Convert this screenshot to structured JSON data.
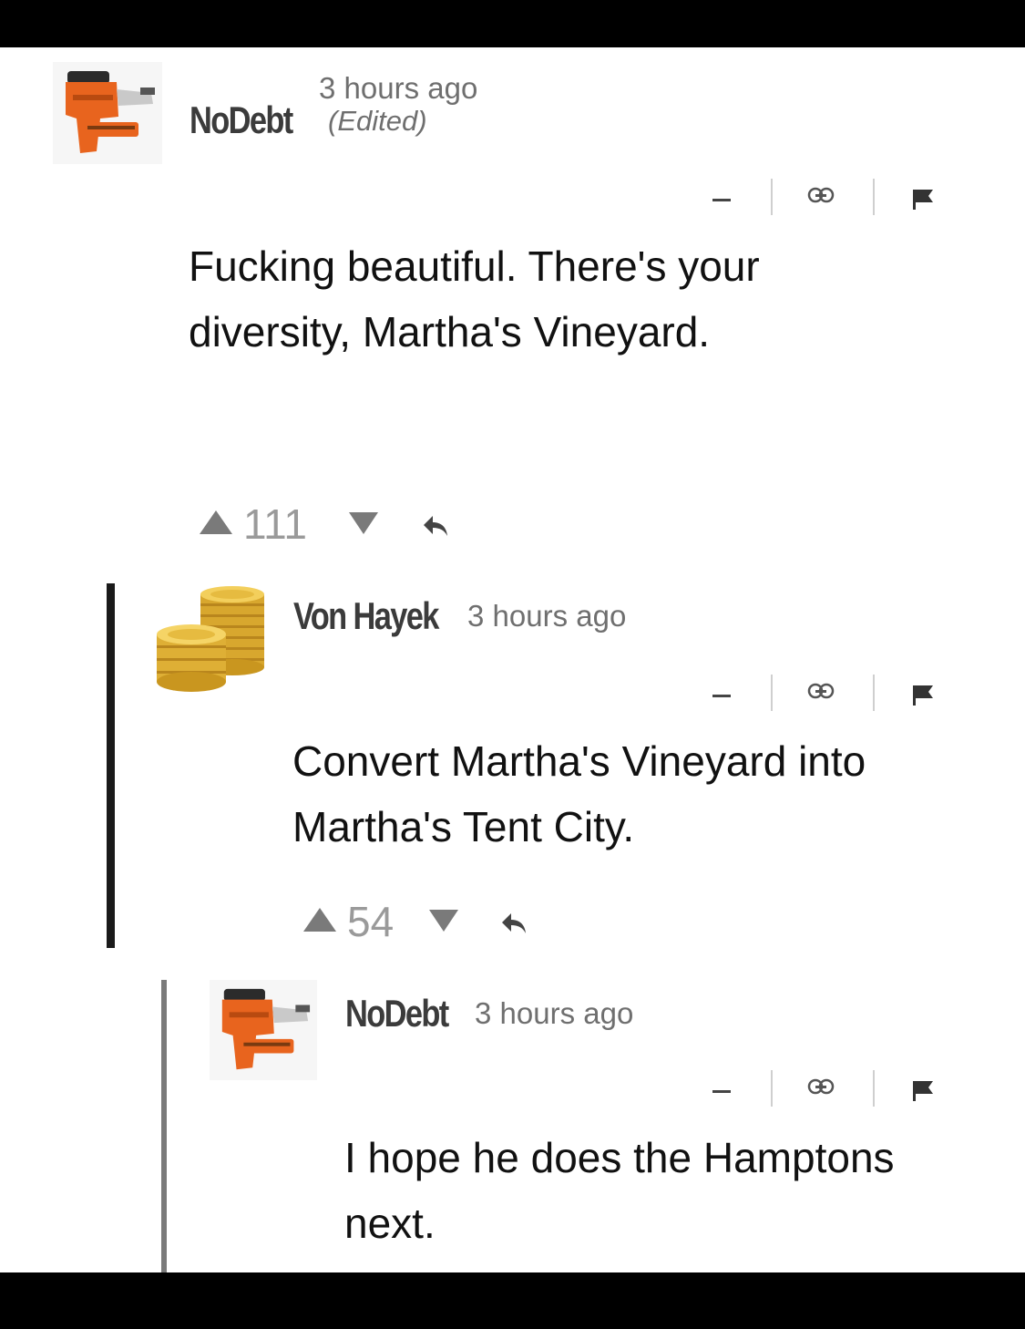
{
  "comments": [
    {
      "username": "NoDebt",
      "timestamp": "3 hours ago",
      "edited": "(Edited)",
      "text_line1": "Fucking beautiful.  There's your",
      "text_line2": "diversity, Martha's Vineyard.",
      "upvotes": "111",
      "avatar_icon": "nail-gun-icon"
    },
    {
      "username": "Von Hayek",
      "timestamp": "3 hours ago",
      "text_line1": "Convert Martha's Vineyard into",
      "text_line2": "Martha's Tent City.",
      "upvotes": "54",
      "avatar_icon": "gold-coins-icon"
    },
    {
      "username": "NoDebt",
      "timestamp": "3 hours ago",
      "text_line1": "I hope he does the Hamptons",
      "text_line2": "next.",
      "avatar_icon": "nail-gun-icon"
    }
  ],
  "colors": {
    "nail_gun_orange": "#e8641e",
    "coin_gold": "#e0b33a",
    "thread_line_dark": "#1a1a1a",
    "thread_line_gray": "#7a7a7a"
  }
}
